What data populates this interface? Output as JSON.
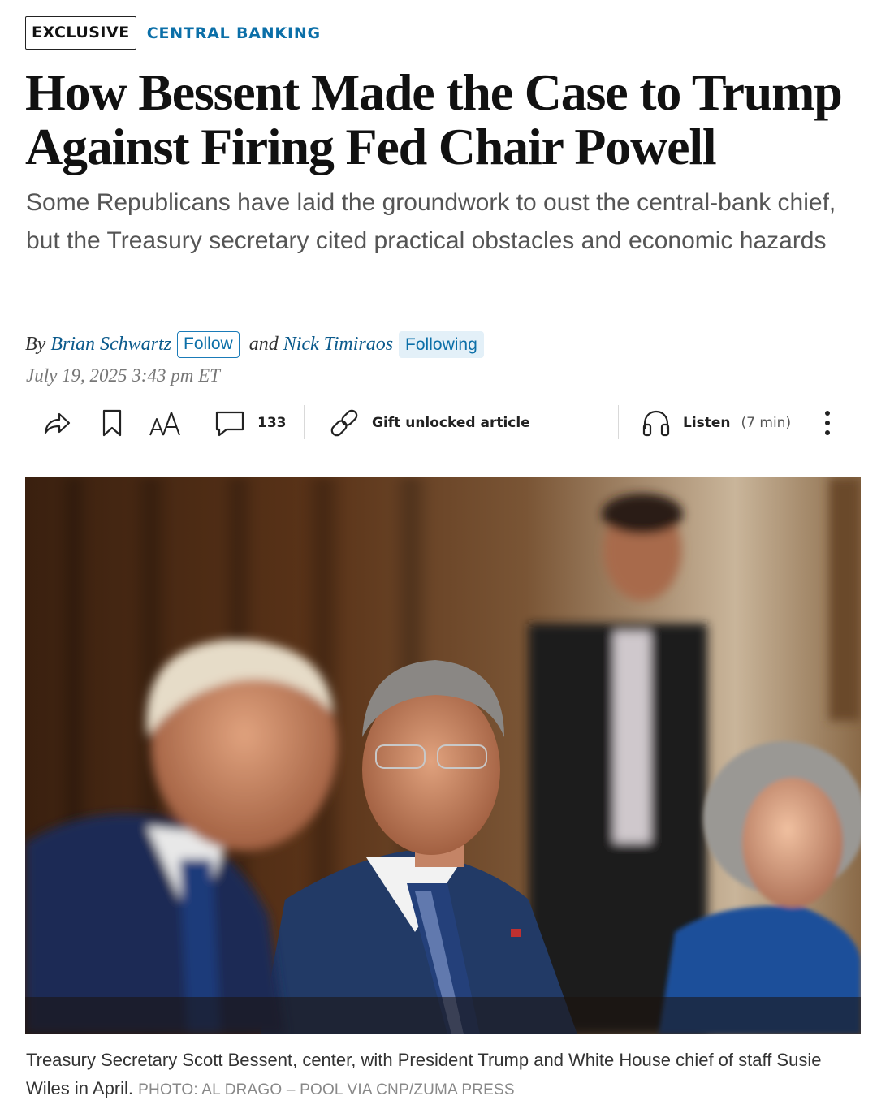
{
  "tags": {
    "exclusive": "EXCLUSIVE",
    "section": "CENTRAL BANKING"
  },
  "headline": "How Bessent Made the Case to Trump Against Firing Fed Chair Powell",
  "dek": "Some Republicans have laid the groundwork to oust the central-bank chief, but the Treasury secretary cited practical obstacles and economic hazards",
  "byline": {
    "by": "By",
    "author1": "Brian Schwartz",
    "author1_action": "Follow",
    "and": "and",
    "author2": "Nick Timiraos",
    "author2_action": "Following"
  },
  "date": "July 19, 2025 3:43 pm ET",
  "toolbar": {
    "share_icon": "share-arrow-icon",
    "bookmark_icon": "bookmark-icon",
    "text_size_icon": "text-size-icon",
    "comment_icon": "comment-icon",
    "comment_count": "133",
    "gift_icon": "link-icon",
    "gift_label": "Gift unlocked article",
    "listen_icon": "headphones-icon",
    "listen_label": "Listen",
    "listen_duration": "(7 min)",
    "more_icon": "more-vertical-icon"
  },
  "photo": {
    "caption": "Treasury Secretary Scott Bessent, center, with President Trump and White House chief of staff Susie Wiles in April.",
    "credit": "PHOTO: AL DRAGO – POOL VIA CNP/ZUMA PRESS"
  },
  "colors": {
    "link_blue": "#0b5a8c",
    "section_blue": "#0b6fa8",
    "following_bg": "#e3f0f8"
  }
}
